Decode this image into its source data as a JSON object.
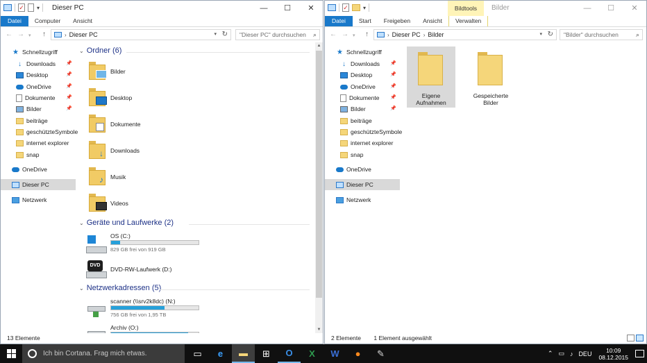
{
  "left_window": {
    "title": "Dieser PC",
    "tabs": [
      "Datei",
      "Computer",
      "Ansicht"
    ],
    "address": [
      "Dieser PC"
    ],
    "search_placeholder": "\"Dieser PC\" durchsuchen",
    "status": "13 Elemente"
  },
  "right_window": {
    "title": "Bilder",
    "context_group": "Bildtools",
    "tabs": [
      "Datei",
      "Start",
      "Freigeben",
      "Ansicht",
      "Verwalten"
    ],
    "address": [
      "Dieser PC",
      "Bilder"
    ],
    "search_placeholder": "\"Bilder\" durchsuchen",
    "status_count": "2 Elemente",
    "status_selected": "1 Element ausgewählt",
    "items": [
      {
        "label_line1": "Eigene",
        "label_line2": "Aufnahmen",
        "selected": true
      },
      {
        "label_line1": "Gespeicherte",
        "label_line2": "Bilder",
        "selected": false
      }
    ]
  },
  "nav_pane": {
    "quick_access": "Schnellzugriff",
    "items": [
      "Downloads",
      "Desktop",
      "OneDrive",
      "Dokumente",
      "Bilder",
      "beiträge",
      "geschützteSymbole",
      "internet explorer",
      "snap"
    ],
    "onedrive": "OneDrive",
    "this_pc": "Dieser PC",
    "network": "Netzwerk"
  },
  "content": {
    "group_folders": "Ordner (6)",
    "folders": [
      "Bilder",
      "Desktop",
      "Dokumente",
      "Downloads",
      "Musik",
      "Videos"
    ],
    "group_drives": "Geräte und Laufwerke (2)",
    "drives": [
      {
        "name": "OS (C:)",
        "free": "829 GB frei von 919 GB",
        "used_fraction": 0.1
      },
      {
        "name": "DVD-RW-Laufwerk (D:)"
      }
    ],
    "group_network": "Netzwerkadressen (5)",
    "network": [
      {
        "name": "scanner (\\\\srv2k8dc) (N:)",
        "free": "756 GB frei von 1,95 TB",
        "used_fraction": 0.61
      },
      {
        "name": "Archiv (O:)",
        "used_fraction": 0.88
      }
    ]
  },
  "taskbar": {
    "cortana": "Ich bin Cortana. Frag mich etwas.",
    "language": "DEU",
    "time": "10:09",
    "date": "08.12.2015"
  },
  "colors": {
    "accent": "#1979ca",
    "folder": "#f5d67a",
    "taskbar": "#101010"
  }
}
